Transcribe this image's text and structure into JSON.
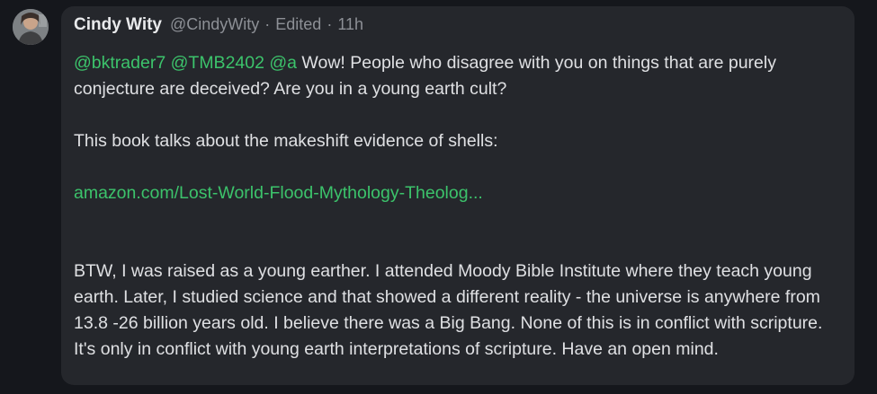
{
  "post": {
    "author_name": "Cindy Wity",
    "author_handle": "@CindyWity",
    "separator": "·",
    "edited_label": "Edited",
    "timestamp": "11h",
    "mentions": [
      "@bktrader7",
      "@TMB2402",
      "@a"
    ],
    "line1_text": " Wow! People who disagree with you on things that are purely conjecture are deceived? Are you in a young earth cult?",
    "paragraph2": "This book talks about the makeshift evidence of shells:",
    "link_text": "amazon.com/Lost-World-Flood-Mythology-Theolog...",
    "paragraph3": "BTW, I was raised as a young earther. I attended Moody Bible Institute where they teach young earth. Later, I studied science and that showed a different reality - the universe is anywhere from 13.8 -26 billion years old. I believe there was a Big Bang. None of this is in conflict with scripture. It's only in conflict with young earth interpretations of scripture. Have an open mind."
  },
  "colors": {
    "background": "#15171c",
    "bubble": "#25272c",
    "mention": "#3cc36b",
    "text": "#dfe0e3",
    "muted": "#8d9096"
  }
}
